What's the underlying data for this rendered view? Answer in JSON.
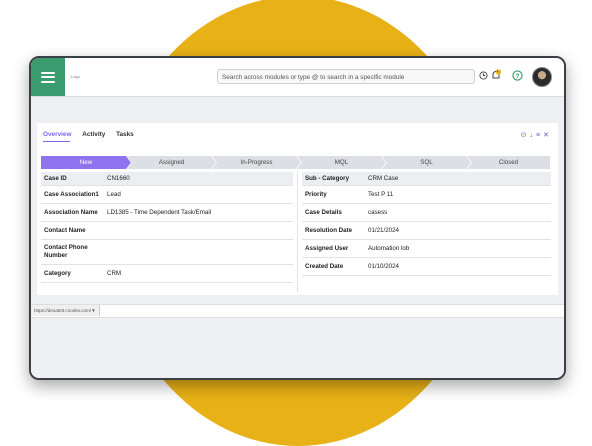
{
  "app": {
    "logo_text": "Logo"
  },
  "search": {
    "placeholder": "Search across modules or type @ to search in a specific module"
  },
  "header": {
    "notification_count": "1"
  },
  "tabs": [
    {
      "label": "Overview",
      "active": true
    },
    {
      "label": "Activity",
      "active": false
    },
    {
      "label": "Tasks",
      "active": false
    }
  ],
  "panel_actions": {
    "icons": [
      "collapse-icon",
      "download-icon",
      "list-icon",
      "close-icon"
    ]
  },
  "stages": [
    {
      "label": "New",
      "current": true
    },
    {
      "label": "Assigned",
      "current": false
    },
    {
      "label": "In-Progress",
      "current": false
    },
    {
      "label": "MQL",
      "current": false
    },
    {
      "label": "SQL",
      "current": false
    },
    {
      "label": "Closed",
      "current": false
    }
  ],
  "left_fields": [
    {
      "label": "Case ID",
      "value": "CN1660"
    },
    {
      "label": "Case Association1",
      "value": "Lead"
    },
    {
      "label": "Association Name",
      "value": "LD1385 - Time Dependent Task/Email"
    },
    {
      "label": "Contact Name",
      "value": ""
    },
    {
      "label": "Contact Phone Number",
      "value": ""
    },
    {
      "label": "Category",
      "value": "CRM"
    }
  ],
  "right_fields": [
    {
      "label": "Sub - Category",
      "value": "CRM Case"
    },
    {
      "label": "Priority",
      "value": "Test P 11"
    },
    {
      "label": "Case Details",
      "value": "casess"
    },
    {
      "label": "Resolution Date",
      "value": "01/21/2024"
    },
    {
      "label": "Assigned User",
      "value": "Automation lob"
    },
    {
      "label": "Created Date",
      "value": "01/10/2024"
    }
  ],
  "status_bar": {
    "url": "https://dexat03.cnodev.com/▼"
  },
  "colors": {
    "accent": "#8e73ee",
    "menu_bg": "#3a9b6e",
    "backdrop_circle": "#e8b117"
  }
}
